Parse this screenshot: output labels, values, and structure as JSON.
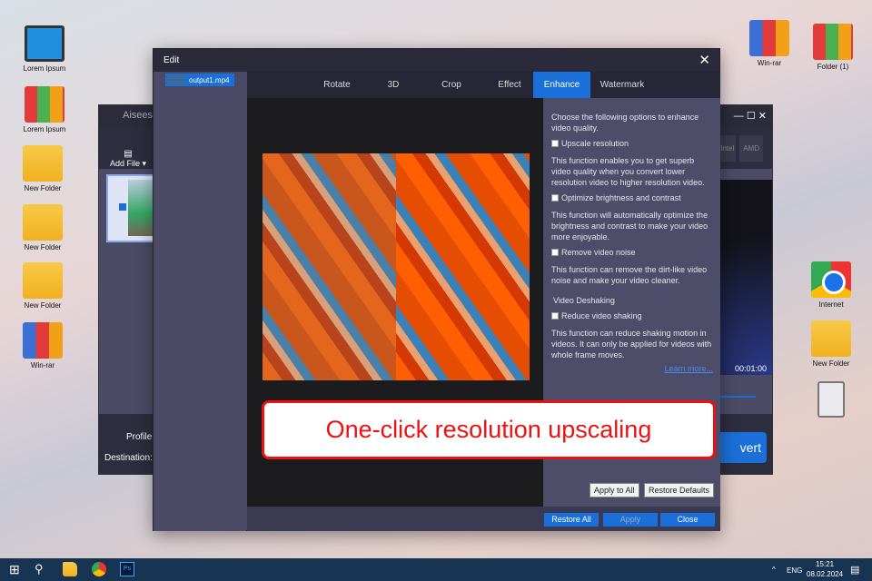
{
  "desktop": {
    "left": [
      "Lorem Ipsum",
      "Lorem Ipsum",
      "New Folder",
      "New Folder",
      "New Folder",
      "Win-rar"
    ],
    "top_right": [
      "Win-rar",
      "Folder (1)"
    ],
    "right": [
      "Internet",
      "New Folder"
    ]
  },
  "back_window": {
    "title": "Aisees",
    "add_file": "Add File",
    "profile": "Profile:",
    "destination": "Destination:",
    "hw": [
      "Intel",
      "AMD"
    ],
    "time": "00:01:00",
    "convert": "vert"
  },
  "edit": {
    "title": "Edit",
    "file": "output1.mp4",
    "tabs": [
      "Rotate",
      "3D",
      "Crop",
      "Effect",
      "Enhance",
      "Watermark"
    ],
    "intro": "Choose the following options to enhance video quality.",
    "options": [
      {
        "label": "Upscale resolution",
        "desc": "This function enables you to get superb video quality when you convert lower resolution video to higher resolution video."
      },
      {
        "label": "Optimize brightness and contrast",
        "desc": "This function will automatically optimize the brightness and contrast to make your video more enjoyable."
      },
      {
        "label": "Remove video noise",
        "desc": "This function can remove the dirt-like video noise and make your video cleaner."
      }
    ],
    "deshake_heading": "Video Deshaking",
    "deshake": {
      "label": "Reduce video shaking",
      "desc": "This function can reduce shaking motion in videos. It can only be applied for videos with whole frame moves."
    },
    "learn_more": "Learn more...",
    "apply_all": "Apply to All",
    "restore_defaults": "Restore Defaults",
    "restore_all": "Restore All",
    "apply": "Apply",
    "close": "Close"
  },
  "callout": "One-click resolution upscaling",
  "taskbar": {
    "lang": "ENG",
    "time": "15:21",
    "date": "08.02.2024"
  }
}
